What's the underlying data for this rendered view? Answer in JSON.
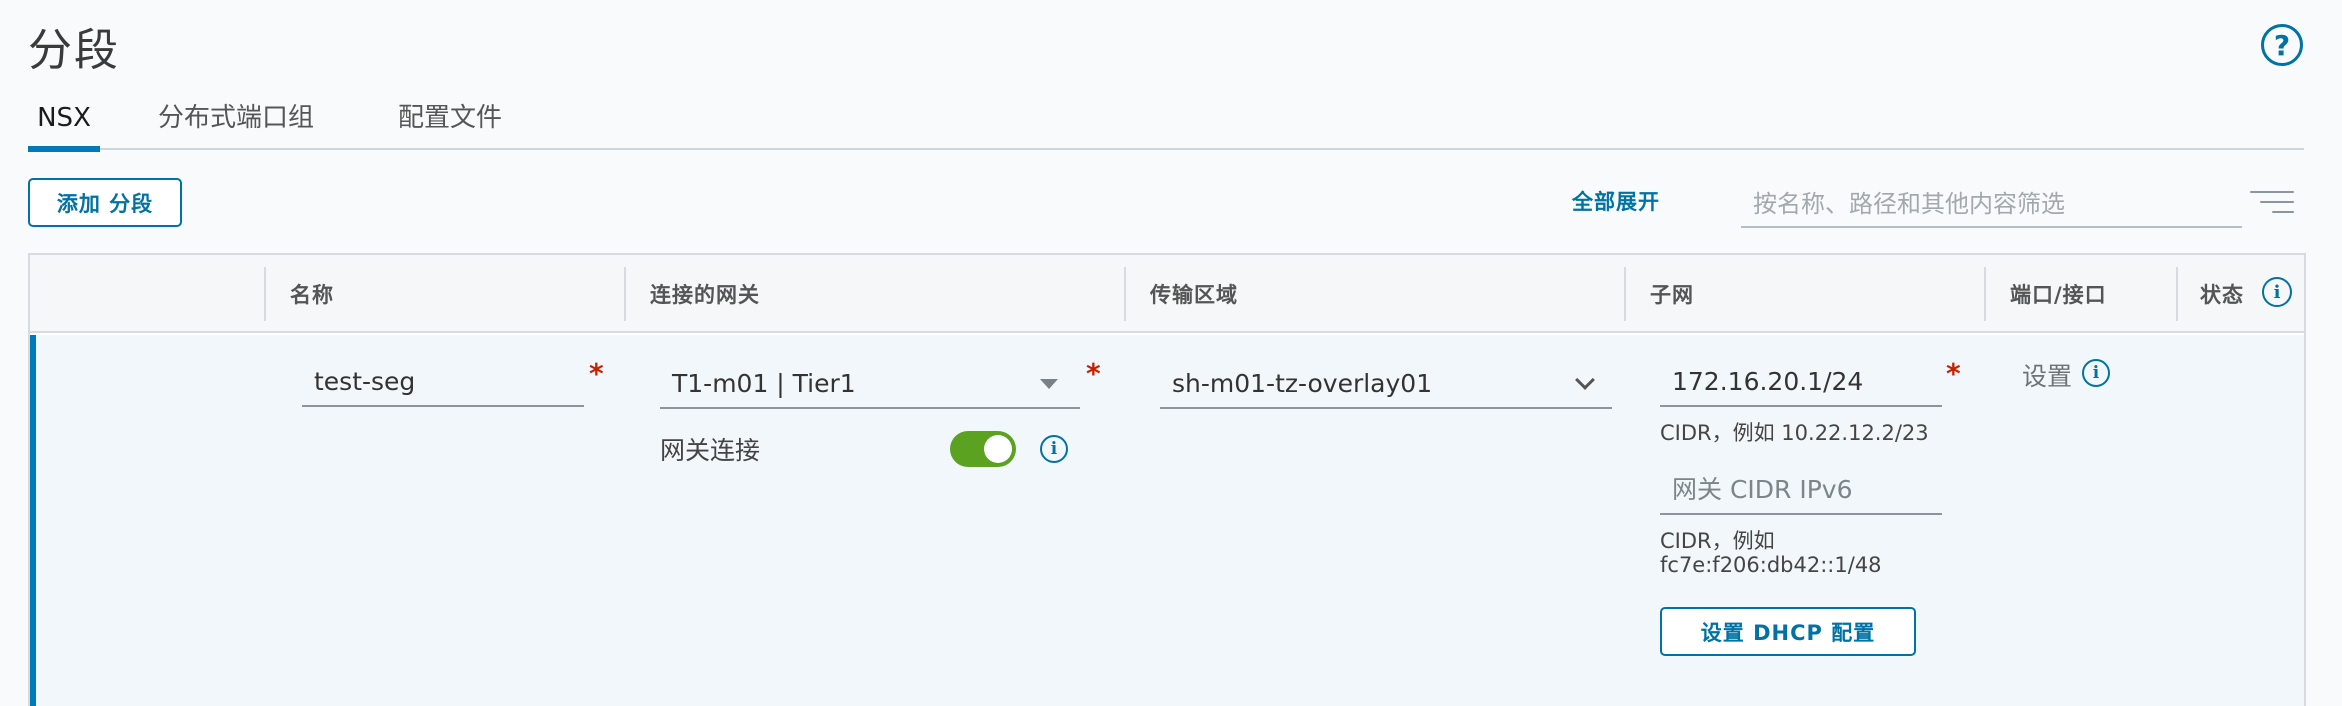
{
  "page": {
    "title": "分段",
    "help_glyph": "?"
  },
  "tabs": [
    {
      "label": "NSX",
      "active": true
    },
    {
      "label": "分布式端口组",
      "active": false
    },
    {
      "label": "配置文件",
      "active": false
    }
  ],
  "toolbar": {
    "add_label": "添加 分段",
    "expand_all_label": "全部展开",
    "filter_placeholder": "按名称、路径和其他内容筛选"
  },
  "grid": {
    "columns": [
      "名称",
      "连接的网关",
      "传输区域",
      "子网",
      "端口/接口",
      "状态"
    ],
    "info_glyph": "i",
    "edit_row": {
      "name_value": "test-seg",
      "required_mark": "*",
      "gateway_value": "T1-m01 | Tier1",
      "gateway_conn_label": "网关连接",
      "gateway_conn_on": true,
      "transport_zone_value": "sh-m01-tz-overlay01",
      "subnet_value": "172.16.20.1/24",
      "subnet_hint": "CIDR，例如 10.22.12.2/23",
      "ipv6_placeholder": "网关 CIDR IPv6",
      "ipv6_hint_line1": "CIDR，例如",
      "ipv6_hint_line2": "fc7e:f206:db42::1/48",
      "dhcp_button_label": "设置 DHCP 配置",
      "ports_set_label": "设置"
    }
  },
  "colors": {
    "accent": "#0072a3",
    "toggle_on": "#5aa220",
    "required": "#c92100"
  }
}
